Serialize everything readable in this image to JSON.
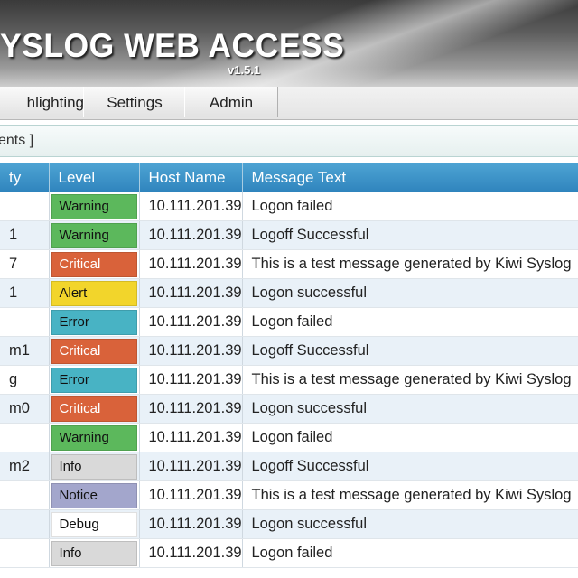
{
  "header": {
    "title": "YSLOG WEB ACCESS",
    "version": "v1.5.1"
  },
  "tabs": [
    {
      "label": "hlighting"
    },
    {
      "label": "Settings"
    },
    {
      "label": "Admin"
    }
  ],
  "breadcrumb": "ents ]",
  "table": {
    "columns": [
      "ty",
      "Level",
      "Host Name",
      "Message Text"
    ],
    "level_colors": {
      "Warning": "#5cb85c",
      "Critical": "#d9623a",
      "Alert": "#f2d52b",
      "Error": "#48b3c4",
      "Info": "#d9d9d9",
      "Notice": "#a3a6cc",
      "Debug": "#ffffff"
    },
    "level_text_colors": {
      "Warning": "#111111",
      "Critical": "#ffffff",
      "Alert": "#111111",
      "Error": "#111111",
      "Info": "#111111",
      "Notice": "#111111",
      "Debug": "#111111"
    },
    "rows": [
      {
        "facility": "",
        "level": "Warning",
        "host": "10.111.201.39",
        "message": "Logon failed"
      },
      {
        "facility": "1",
        "level": "Warning",
        "host": "10.111.201.39",
        "message": "Logoff Successful"
      },
      {
        "facility": "7",
        "level": "Critical",
        "host": "10.111.201.39",
        "message": "This is a test message generated by Kiwi Syslog"
      },
      {
        "facility": "1",
        "level": "Alert",
        "host": "10.111.201.39",
        "message": "Logon successful"
      },
      {
        "facility": "",
        "level": "Error",
        "host": "10.111.201.39",
        "message": "Logon failed"
      },
      {
        "facility": "m1",
        "level": "Critical",
        "host": "10.111.201.39",
        "message": "Logoff Successful"
      },
      {
        "facility": "g",
        "level": "Error",
        "host": "10.111.201.39",
        "message": "This is a test message generated by Kiwi Syslog"
      },
      {
        "facility": "m0",
        "level": "Critical",
        "host": "10.111.201.39",
        "message": "Logon successful"
      },
      {
        "facility": "",
        "level": "Warning",
        "host": "10.111.201.39",
        "message": "Logon failed"
      },
      {
        "facility": "m2",
        "level": "Info",
        "host": "10.111.201.39",
        "message": "Logoff Successful"
      },
      {
        "facility": "",
        "level": "Notice",
        "host": "10.111.201.39",
        "message": "This is a test message generated by Kiwi Syslog"
      },
      {
        "facility": "",
        "level": "Debug",
        "host": "10.111.201.39",
        "message": "Logon successful"
      },
      {
        "facility": "",
        "level": "Info",
        "host": "10.111.201.39",
        "message": "Logon failed"
      }
    ]
  }
}
